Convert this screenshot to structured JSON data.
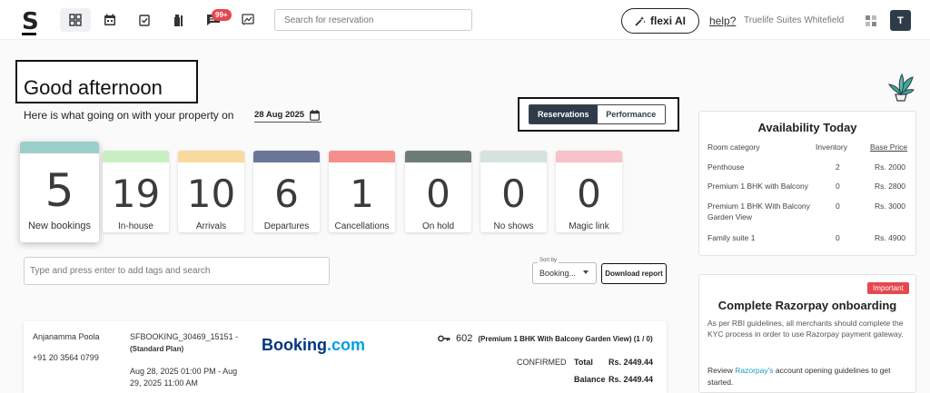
{
  "topbar": {
    "logo": "S",
    "notif_badge": "99+",
    "search_placeholder": "Search for reservation",
    "flexi_label": "flexi AI",
    "help": "help?",
    "property": "Truelife Suites Whitefield",
    "avatar": "T"
  },
  "greeting": {
    "title": "Good afternoon",
    "subtitle": "Here is what going on with your property on",
    "date": "28 Aug 2025"
  },
  "toggle": {
    "reservations": "Reservations",
    "performance": "Performance"
  },
  "stats": [
    {
      "value": "5",
      "label": "New bookings",
      "color": "#9ccfc9"
    },
    {
      "value": "19",
      "label": "In-house",
      "color": "#c7efc2"
    },
    {
      "value": "10",
      "label": "Arrivals",
      "color": "#f8d99e"
    },
    {
      "value": "6",
      "label": "Departures",
      "color": "#6a7797"
    },
    {
      "value": "1",
      "label": "Cancellations",
      "color": "#f48f8c"
    },
    {
      "value": "0",
      "label": "On hold",
      "color": "#6e7c76"
    },
    {
      "value": "0",
      "label": "No shows",
      "color": "#d6e2dc"
    },
    {
      "value": "0",
      "label": "Magic link",
      "color": "#f9c1c9"
    }
  ],
  "filters": {
    "tag_placeholder": "Type and press enter to add tags and search",
    "sort_label": "Sort by",
    "sort_value": "Booking...",
    "download": "Download report"
  },
  "booking": {
    "guest": "Anjanamma Poola",
    "phone": "+91 20 3564 0799",
    "id": "SFBOOKING_30469_15151 -",
    "plan": "(Standard Plan)",
    "dates": "Aug 28, 2025 01:00 PM - Aug 29, 2025 11:00 AM",
    "source_main": "Booking",
    "source_suffix": ".com",
    "room": "602",
    "room_detail": "(Premium 1 BHK With Balcony Garden View)  (1 / 0)",
    "status": "CONFIRMED",
    "total_label": "Total",
    "total_value": "Rs. 2449.44",
    "balance_label": "Balance",
    "balance_value": "Rs. 2449.44"
  },
  "availability": {
    "title": "Availability Today",
    "headers": {
      "category": "Room category",
      "inventory": "Inventory",
      "base": "Base Price"
    },
    "rows": [
      {
        "category": "Penthouse",
        "inventory": "2",
        "price": "Rs. 2000"
      },
      {
        "category": "Premium 1 BHK with Balcony",
        "inventory": "0",
        "price": "Rs. 2800"
      },
      {
        "category": "Premium 1 BHK With Balcony Garden View",
        "inventory": "0",
        "price": "Rs. 3000"
      },
      {
        "category": "Family suite 1",
        "inventory": "0",
        "price": "Rs. 4900"
      }
    ]
  },
  "razorpay": {
    "badge": "Important",
    "title": "Complete Razorpay onboarding",
    "body": "As per RBI guidelines, all merchants should complete the KYC process in order to use Razorpay payment gateway.",
    "review_prefix": "Review ",
    "review_link": "Razorpay's",
    "review_suffix": " account opening guidelines to get started."
  }
}
